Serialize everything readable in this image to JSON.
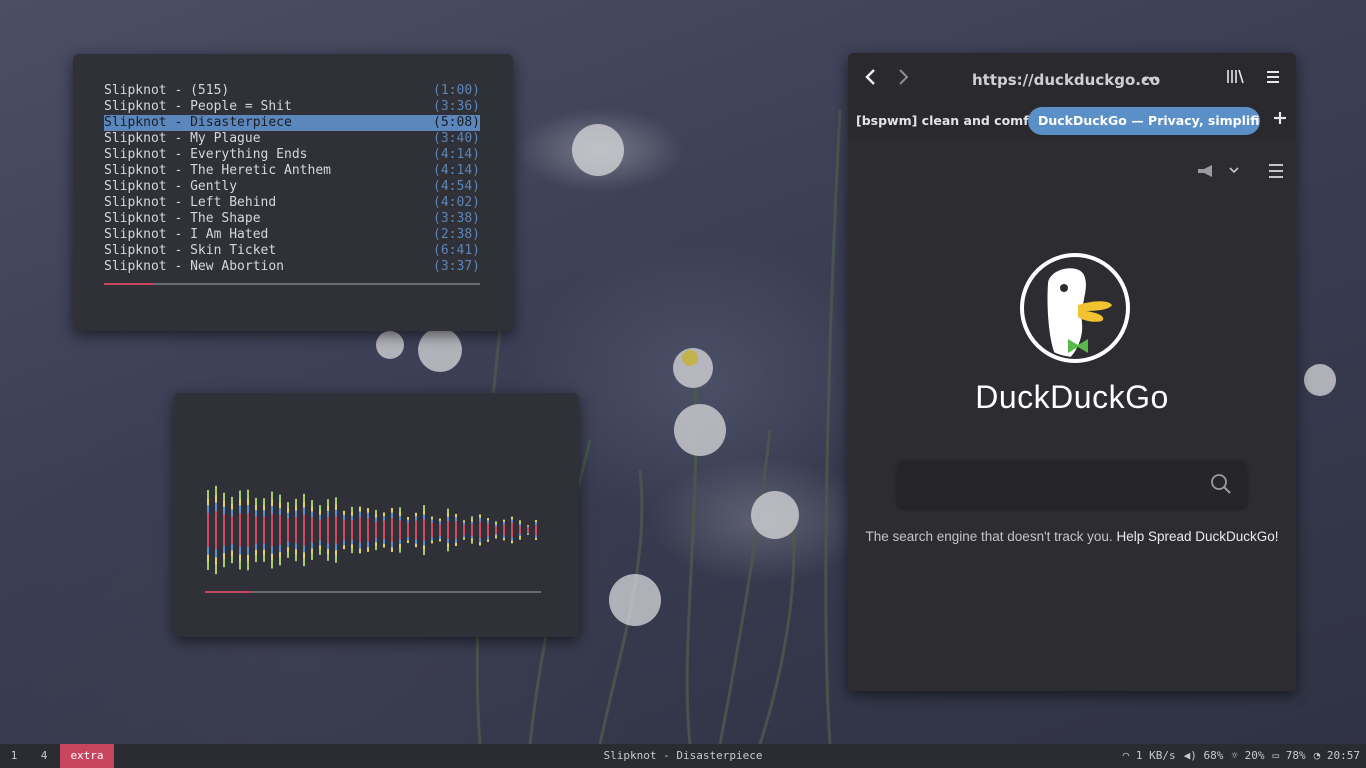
{
  "player": {
    "tracks": [
      {
        "title": "Slipknot - (515)",
        "duration": "(1:00)"
      },
      {
        "title": "Slipknot - People = Shit",
        "duration": "(3:36)"
      },
      {
        "title": "Slipknot - Disasterpiece",
        "duration": "(5:08)"
      },
      {
        "title": "Slipknot - My Plague",
        "duration": "(3:40)"
      },
      {
        "title": "Slipknot - Everything Ends",
        "duration": "(4:14)"
      },
      {
        "title": "Slipknot - The Heretic Anthem",
        "duration": "(4:14)"
      },
      {
        "title": "Slipknot - Gently",
        "duration": "(4:54)"
      },
      {
        "title": "Slipknot - Left Behind",
        "duration": "(4:02)"
      },
      {
        "title": "Slipknot - The Shape",
        "duration": "(3:38)"
      },
      {
        "title": "Slipknot - I Am Hated",
        "duration": "(2:38)"
      },
      {
        "title": "Slipknot - Skin Ticket",
        "duration": "(6:41)"
      },
      {
        "title": "Slipknot - New Abortion",
        "duration": "(3:37)"
      }
    ],
    "selected_index": 2,
    "progress": 0.13
  },
  "visualizer": {
    "progress": 0.14,
    "colors": {
      "green": "#a6cc70",
      "yellow": "#e0d36b",
      "red": "#d04a5f",
      "blue": "#5b8fcf"
    }
  },
  "browser": {
    "url_bold": "https://duckduckgo.co",
    "url_dim": "",
    "tabs": [
      "[bspwm] clean and comfy : unixporn",
      "DuckDuckGo — Privacy, simplified."
    ],
    "active_tab": 1,
    "page_title": "DuckDuckGo",
    "search_placeholder": "",
    "tagline": "The search engine that doesn't track you.",
    "tagline_link": "Help Spread DuckDuckGo!"
  },
  "panel": {
    "workspaces": [
      "1",
      "4",
      "extra"
    ],
    "active_workspace": 2,
    "window_title": "Slipknot - Disasterpiece",
    "net": "1 KB/s",
    "volume": "68%",
    "brightness": "20%",
    "battery": "78%",
    "clock": "20:57"
  },
  "colors": {
    "accent": "#c8445f",
    "selection": "#5b87bd",
    "duration": "#5b86b6"
  }
}
